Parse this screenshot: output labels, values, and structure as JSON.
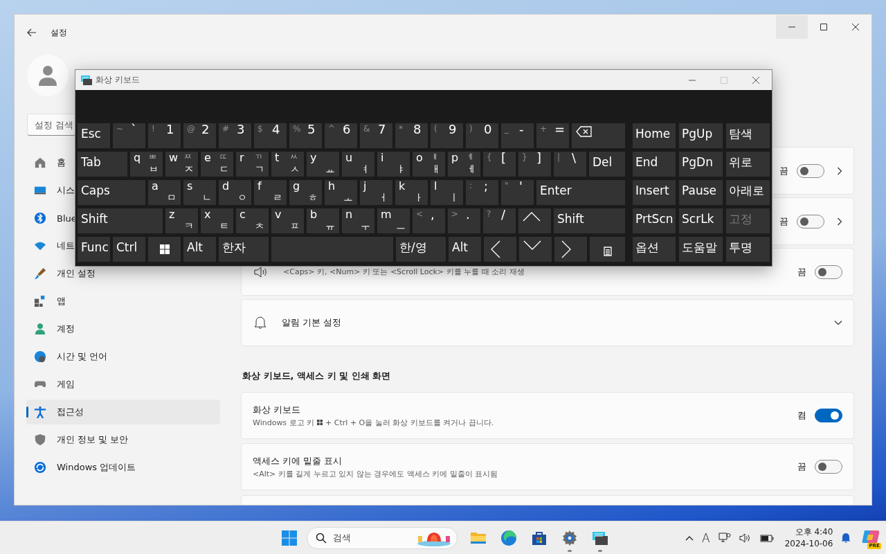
{
  "settings_window": {
    "title": "설정",
    "search_placeholder": "설정 검색",
    "nav": [
      {
        "label": "홈",
        "selected": false
      },
      {
        "label": "시스",
        "selected": false
      },
      {
        "label": "Blue",
        "selected": false
      },
      {
        "label": "네트",
        "selected": false
      },
      {
        "label": "개인 설정",
        "selected": false
      },
      {
        "label": "앱",
        "selected": false
      },
      {
        "label": "계정",
        "selected": false
      },
      {
        "label": "시간 및 언어",
        "selected": false
      },
      {
        "label": "게임",
        "selected": false
      },
      {
        "label": "접근성",
        "selected": true
      },
      {
        "label": "개인 정보 및 보안",
        "selected": false
      },
      {
        "label": "Windows 업데이트",
        "selected": false
      }
    ],
    "cards": [
      {
        "kind": "toggle",
        "state_label": "끔",
        "on": false,
        "chevron": true
      },
      {
        "kind": "toggle",
        "state_label": "끔",
        "on": false,
        "chevron": true
      },
      {
        "kind": "toggle",
        "description": "<Caps> 키, <Num> 키 또는 <Scroll Lock> 키를 누를 때 소리 재생",
        "state_label": "끔",
        "on": false,
        "chevron": false
      },
      {
        "kind": "expander",
        "title": "알림 기본 설정"
      }
    ],
    "section_heading": "화상 키보드, 액세스 키 및 인쇄 화면",
    "section_cards": [
      {
        "kind": "toggle",
        "title": "화상 키보드",
        "description": "Windows 로고 키",
        "description_rest": "+ Ctrl + O을 눌러 화상 키보드를 켜거나 끕니다.",
        "state_label": "켬",
        "on": true
      },
      {
        "kind": "toggle",
        "title": "액세스 키에 밑줄 표시",
        "description": "<Alt> 키를 길게 누르고 있지 않는 경우에도 액세스 키에 밑줄이 표시됨",
        "state_label": "끔",
        "on": false
      },
      {
        "kind": "blank"
      }
    ]
  },
  "keyboard_window": {
    "title": "화상 키보드",
    "rows": [
      [
        {
          "kind": "label",
          "label": "Esc"
        },
        {
          "kind": "symbol",
          "shift": "~",
          "main": "`"
        },
        {
          "kind": "symbol",
          "shift": "!",
          "main": "1"
        },
        {
          "kind": "symbol",
          "shift": "@",
          "main": "2"
        },
        {
          "kind": "symbol",
          "shift": "#",
          "main": "3"
        },
        {
          "kind": "symbol",
          "shift": "$",
          "main": "4"
        },
        {
          "kind": "symbol",
          "shift": "%",
          "main": "5"
        },
        {
          "kind": "symbol",
          "shift": "^",
          "main": "6"
        },
        {
          "kind": "symbol",
          "shift": "&",
          "main": "7"
        },
        {
          "kind": "symbol",
          "shift": "*",
          "main": "8"
        },
        {
          "kind": "symbol",
          "shift": "(",
          "main": "9"
        },
        {
          "kind": "symbol",
          "shift": ")",
          "main": "0"
        },
        {
          "kind": "symbol",
          "shift": "_",
          "main": "-"
        },
        {
          "kind": "symbol",
          "shift": "+",
          "main": "="
        },
        {
          "kind": "backspace"
        }
      ],
      [
        {
          "kind": "label",
          "label": "Tab"
        },
        {
          "kind": "letter",
          "letter": "q",
          "shift": "ㅃ",
          "jamo": "ㅂ"
        },
        {
          "kind": "letter",
          "letter": "w",
          "shift": "ㅉ",
          "jamo": "ㅈ"
        },
        {
          "kind": "letter",
          "letter": "e",
          "shift": "ㄸ",
          "jamo": "ㄷ"
        },
        {
          "kind": "letter",
          "letter": "r",
          "shift": "ㄲ",
          "jamo": "ㄱ"
        },
        {
          "kind": "letter",
          "letter": "t",
          "shift": "ㅆ",
          "jamo": "ㅅ"
        },
        {
          "kind": "letter",
          "letter": "y",
          "jamo": "ㅛ"
        },
        {
          "kind": "letter",
          "letter": "u",
          "jamo": "ㅕ"
        },
        {
          "kind": "letter",
          "letter": "i",
          "jamo": "ㅑ"
        },
        {
          "kind": "letter",
          "letter": "o",
          "shift": "ㅒ",
          "jamo": "ㅐ"
        },
        {
          "kind": "letter",
          "letter": "p",
          "shift": "ㅖ",
          "jamo": "ㅔ"
        },
        {
          "kind": "symbol",
          "shift": "{",
          "main": "["
        },
        {
          "kind": "symbol",
          "shift": "}",
          "main": "]"
        },
        {
          "kind": "symbol",
          "shift": "|",
          "main": "\\"
        },
        {
          "kind": "label",
          "label": "Del"
        }
      ],
      [
        {
          "kind": "label",
          "label": "Caps"
        },
        {
          "kind": "letter",
          "letter": "a",
          "jamo": "ㅁ"
        },
        {
          "kind": "letter",
          "letter": "s",
          "jamo": "ㄴ"
        },
        {
          "kind": "letter",
          "letter": "d",
          "jamo": "ㅇ"
        },
        {
          "kind": "letter",
          "letter": "f",
          "jamo": "ㄹ"
        },
        {
          "kind": "letter",
          "letter": "g",
          "jamo": "ㅎ"
        },
        {
          "kind": "letter",
          "letter": "h",
          "jamo": "ㅗ"
        },
        {
          "kind": "letter",
          "letter": "j",
          "jamo": "ㅓ"
        },
        {
          "kind": "letter",
          "letter": "k",
          "jamo": "ㅏ"
        },
        {
          "kind": "letter",
          "letter": "l",
          "jamo": "ㅣ"
        },
        {
          "kind": "symbol",
          "shift": ":",
          "main": ";"
        },
        {
          "kind": "symbol",
          "shift": "\"",
          "main": "'"
        },
        {
          "kind": "label",
          "label": "Enter"
        }
      ],
      [
        {
          "kind": "label",
          "label": "Shift"
        },
        {
          "kind": "letter",
          "letter": "z",
          "jamo": "ㅋ"
        },
        {
          "kind": "letter",
          "letter": "x",
          "jamo": "ㅌ"
        },
        {
          "kind": "letter",
          "letter": "c",
          "jamo": "ㅊ"
        },
        {
          "kind": "letter",
          "letter": "v",
          "jamo": "ㅍ"
        },
        {
          "kind": "letter",
          "letter": "b",
          "jamo": "ㅠ"
        },
        {
          "kind": "letter",
          "letter": "n",
          "jamo": "ㅜ"
        },
        {
          "kind": "letter",
          "letter": "m",
          "jamo": "ㅡ"
        },
        {
          "kind": "symbol",
          "shift": "<",
          "main": ","
        },
        {
          "kind": "symbol",
          "shift": ">",
          "main": "."
        },
        {
          "kind": "symbol",
          "shift": "?",
          "main": "/"
        },
        {
          "kind": "up"
        },
        {
          "kind": "label",
          "label": "Shift"
        }
      ],
      [
        {
          "kind": "label",
          "label": "Func"
        },
        {
          "kind": "label",
          "label": "Ctrl"
        },
        {
          "kind": "windows"
        },
        {
          "kind": "label",
          "label": "Alt"
        },
        {
          "kind": "label",
          "label": "한자"
        },
        {
          "kind": "blank"
        },
        {
          "kind": "label",
          "label": "한/영"
        },
        {
          "kind": "label",
          "label": "Alt"
        },
        {
          "kind": "left"
        },
        {
          "kind": "down"
        },
        {
          "kind": "right"
        },
        {
          "kind": "menu"
        }
      ]
    ],
    "side_keys": [
      {
        "label": "Home",
        "disabled": false
      },
      {
        "label": "PgUp",
        "disabled": false
      },
      {
        "label": "탐색",
        "disabled": false
      },
      {
        "label": "End",
        "disabled": false
      },
      {
        "label": "PgDn",
        "disabled": false
      },
      {
        "label": "위로",
        "disabled": false
      },
      {
        "label": "Insert",
        "disabled": false
      },
      {
        "label": "Pause",
        "disabled": false
      },
      {
        "label": "아래로",
        "disabled": false
      },
      {
        "label": "PrtScn",
        "disabled": false
      },
      {
        "label": "ScrLk",
        "disabled": false
      },
      {
        "label": "고정",
        "disabled": true
      },
      {
        "label": "옵션",
        "disabled": false
      },
      {
        "label": "도움말",
        "disabled": false
      },
      {
        "label": "투명",
        "disabled": false
      }
    ]
  },
  "taskbar": {
    "search_placeholder": "검색",
    "apps": [
      {
        "running": false
      },
      {
        "running": false
      },
      {
        "running": false
      },
      {
        "running": true
      },
      {
        "running": true
      }
    ],
    "ime_indicator": "A",
    "time": "오후 4:40",
    "date": "2024-10-06",
    "copilot_badge": "PRE"
  }
}
